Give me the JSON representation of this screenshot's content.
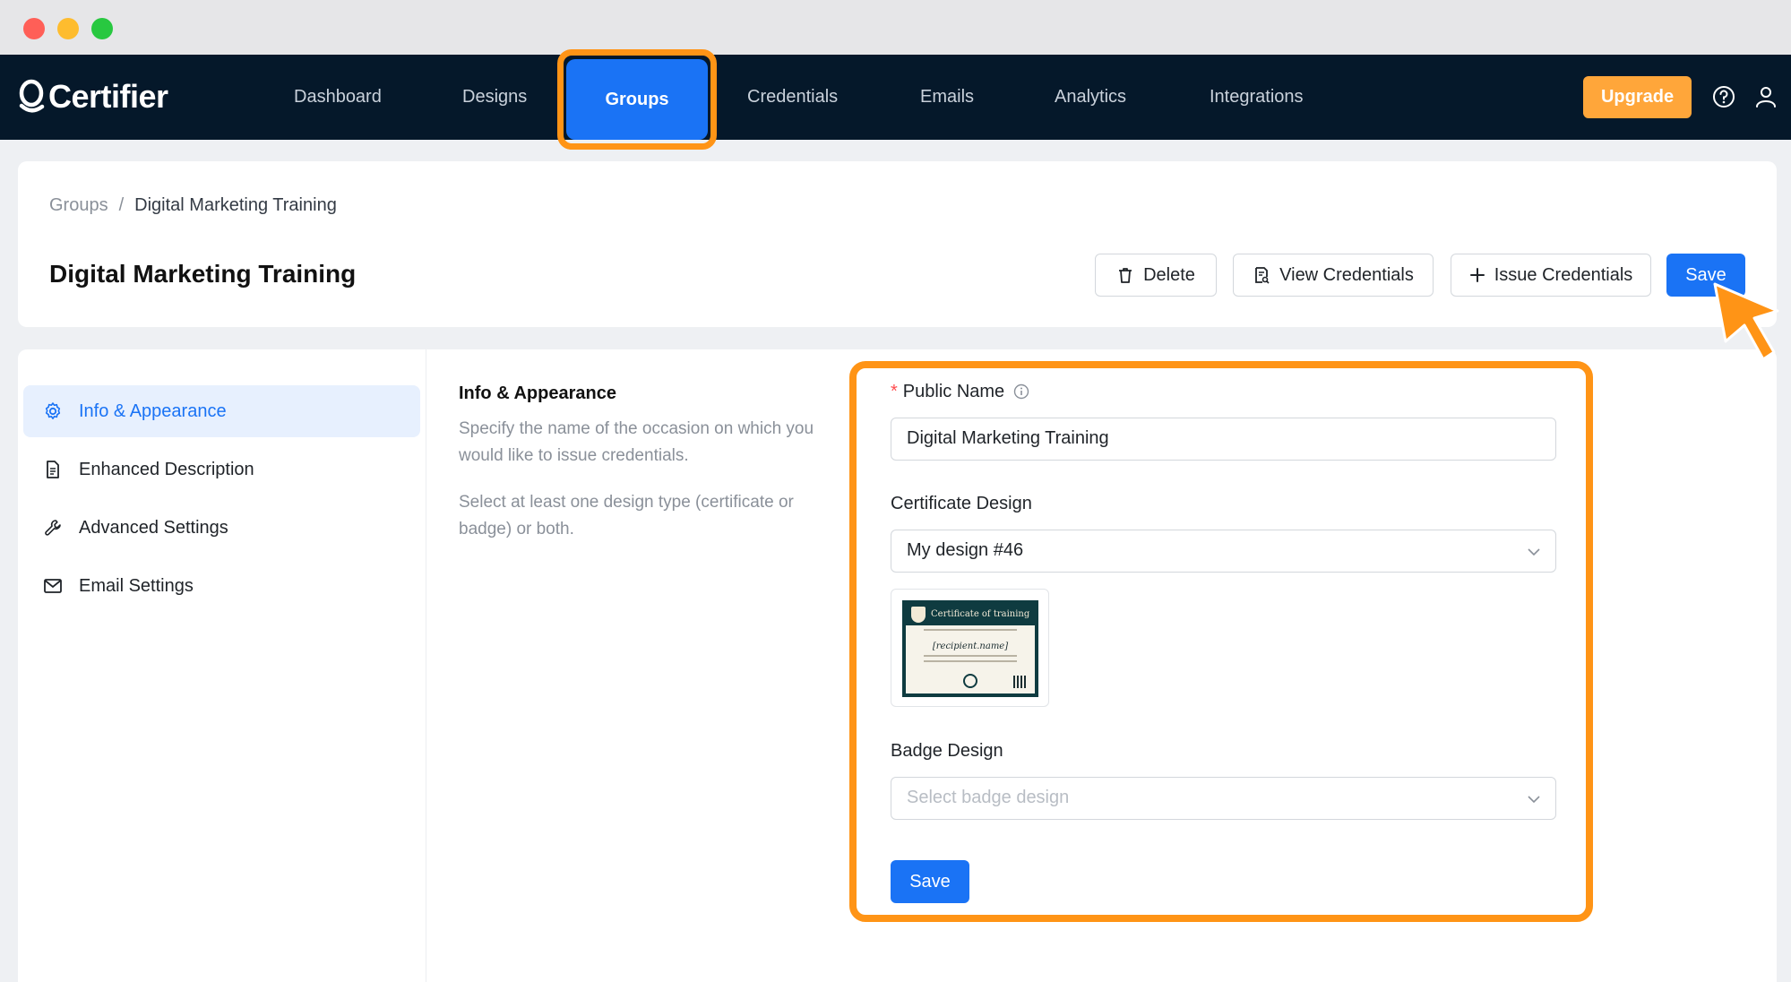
{
  "app": {
    "name": "Certifier"
  },
  "nav": {
    "items": [
      "Dashboard",
      "Designs",
      "Groups",
      "Credentials",
      "Emails",
      "Analytics",
      "Integrations"
    ],
    "active": "Groups",
    "upgrade_label": "Upgrade",
    "icons": [
      "help-circle-icon",
      "user-icon"
    ]
  },
  "breadcrumb": {
    "parent": "Groups",
    "separator": "/",
    "current": "Digital Marketing Training"
  },
  "page": {
    "title": "Digital Marketing Training"
  },
  "toolbar": {
    "delete_label": "Delete",
    "view_label": "View Credentials",
    "issue_label": "Issue Credentials",
    "save_label": "Save"
  },
  "sidebar": {
    "items": [
      {
        "label": "Info & Appearance",
        "icon": "gear-icon",
        "active": true
      },
      {
        "label": "Enhanced Description",
        "icon": "document-icon",
        "active": false
      },
      {
        "label": "Advanced Settings",
        "icon": "wrench-icon",
        "active": false
      },
      {
        "label": "Email Settings",
        "icon": "mail-icon",
        "active": false
      }
    ]
  },
  "section": {
    "title": "Info & Appearance",
    "desc1": "Specify the name of the occasion on which you would like to issue credentials.",
    "desc2": "Select at least one design type (certificate or badge) or both."
  },
  "form": {
    "public_name_label": "Public Name",
    "public_name_value": "Digital Marketing Training",
    "certificate_label": "Certificate Design",
    "certificate_value": "My design #46",
    "certificate_preview": {
      "title": "Certificate of training",
      "name": "[recipient.name]"
    },
    "badge_label": "Badge Design",
    "badge_placeholder": "Select badge design",
    "save_label": "Save"
  },
  "colors": {
    "navbar": "#05182a",
    "primary": "#1a73f5",
    "highlight": "#ff9416",
    "upgrade": "#ffa63a"
  }
}
